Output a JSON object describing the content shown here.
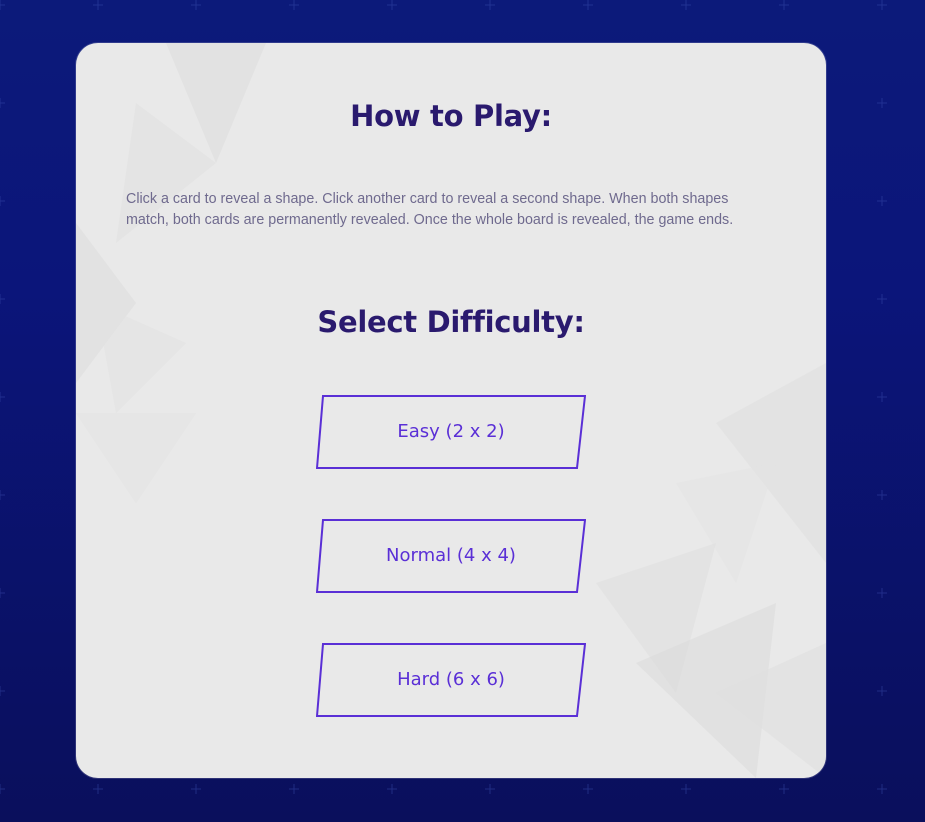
{
  "how_to_play": {
    "title": "How to Play:",
    "text": "Click a card to reveal a shape. Click another card to reveal a second shape. When both shapes match, both cards are permanently revealed. Once the whole board is revealed, the game ends."
  },
  "difficulty": {
    "title": "Select Difficulty:",
    "options": [
      {
        "label": "Easy (2 x 2)"
      },
      {
        "label": "Normal (4 x 4)"
      },
      {
        "label": "Hard (6 x 6)"
      }
    ]
  },
  "colors": {
    "background": "#0b157a",
    "panel": "#e9e9e9",
    "heading": "#2a1a6e",
    "body_text": "#6f6a8e",
    "accent": "#5a2fd6"
  }
}
